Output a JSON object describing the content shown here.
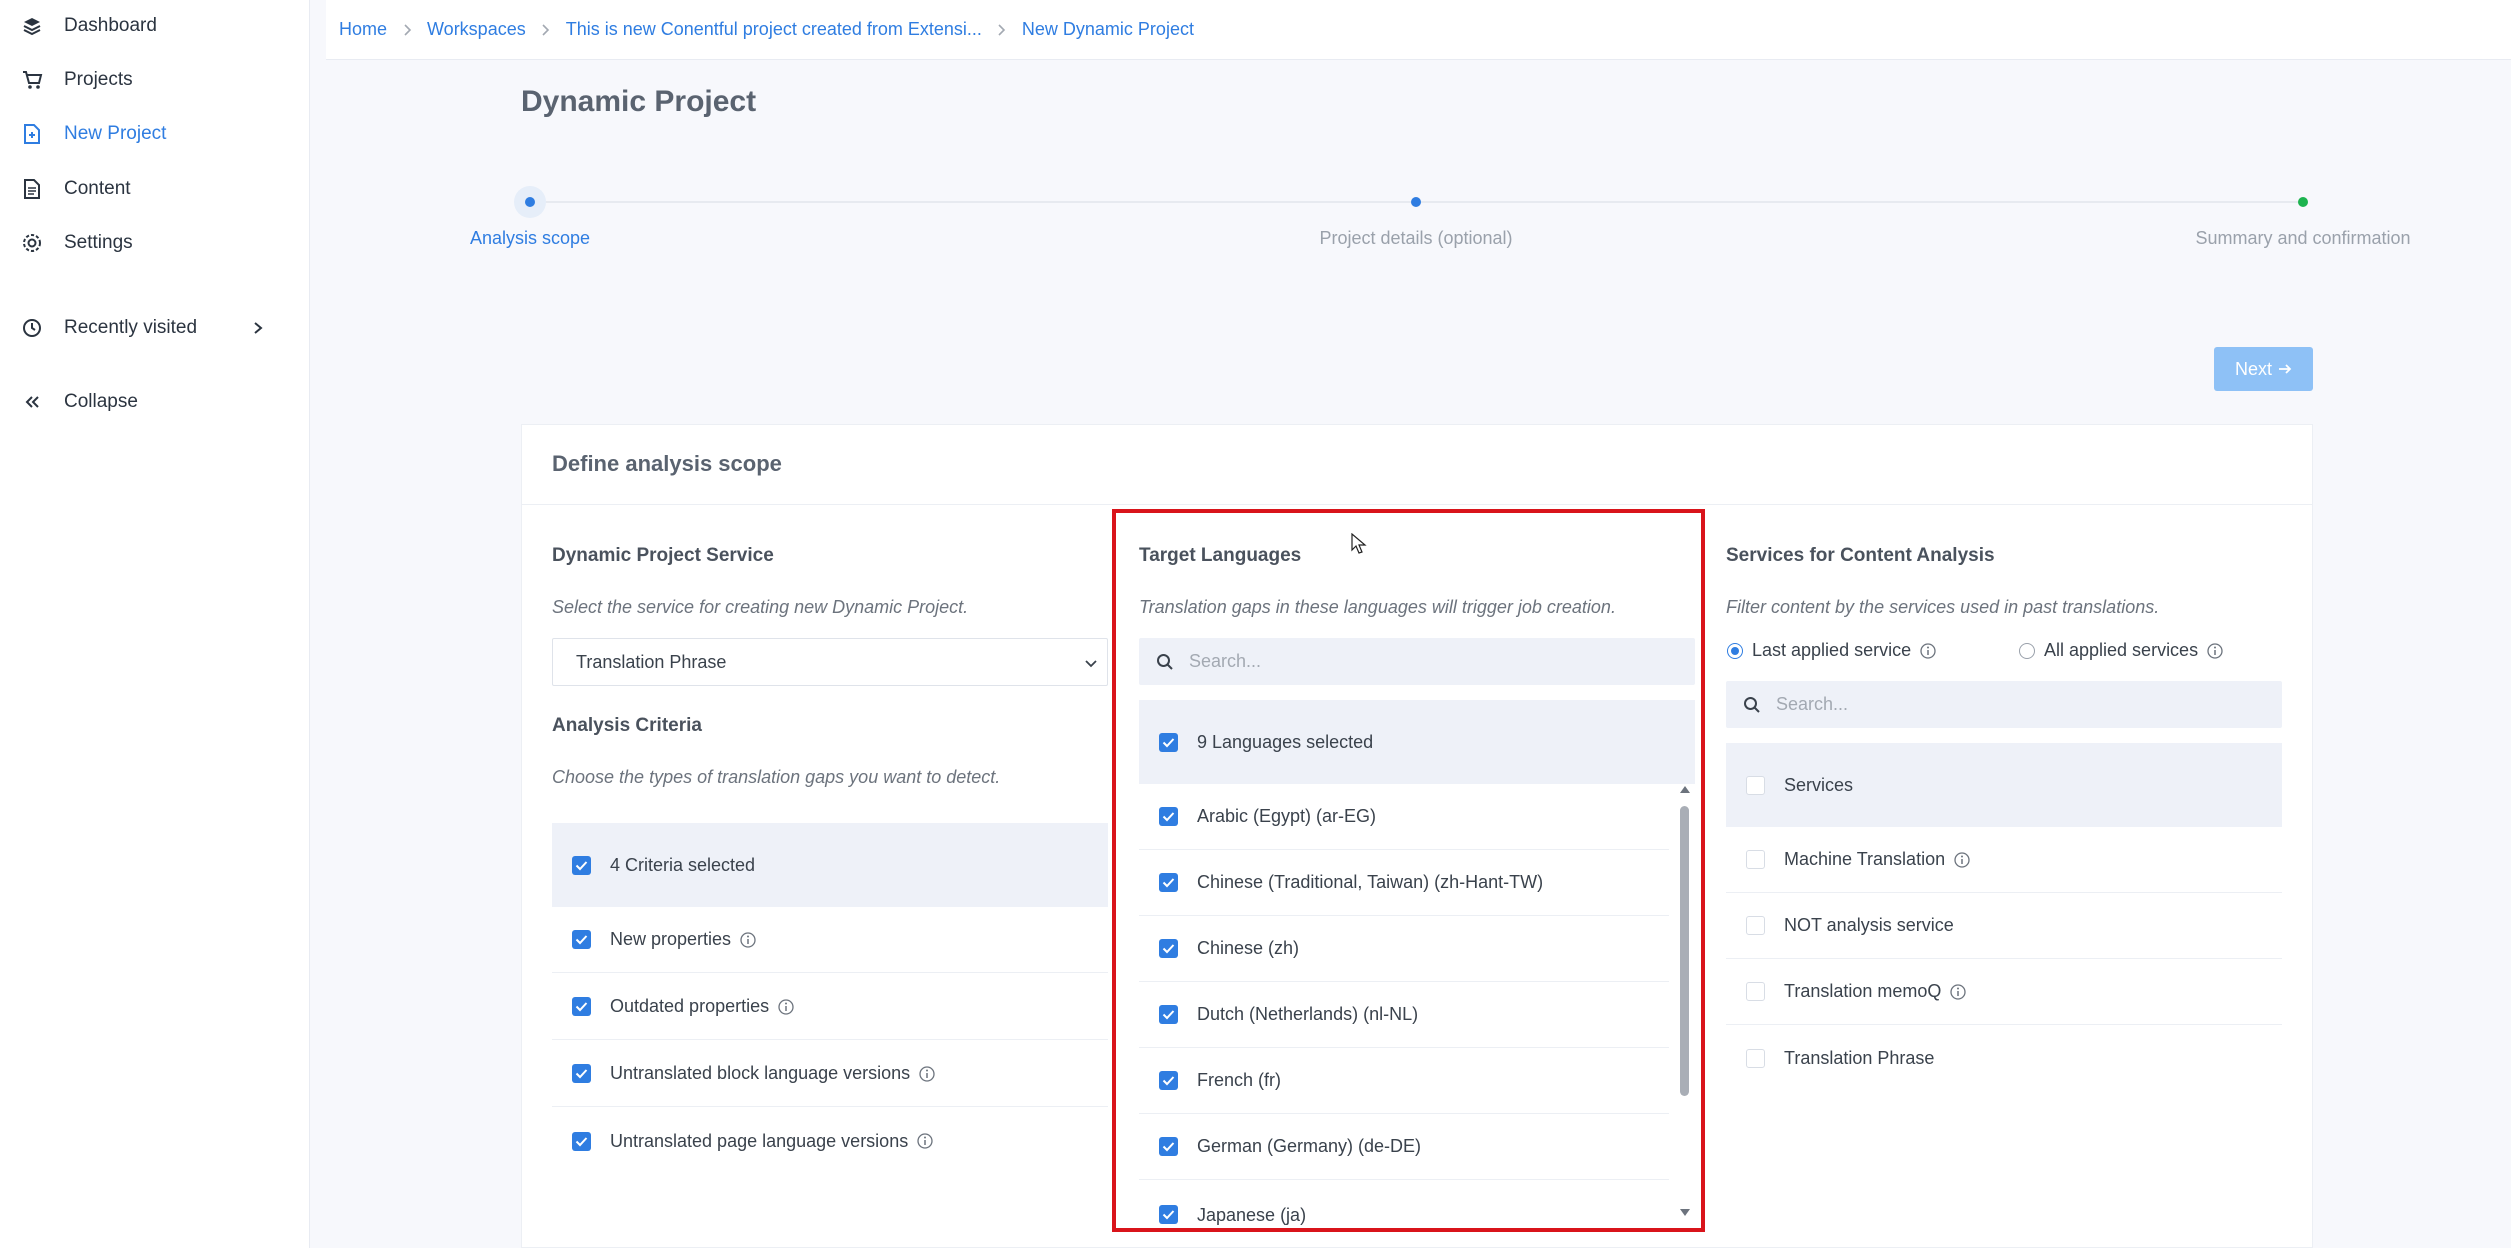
{
  "sidebar": {
    "items": [
      {
        "label": "Dashboard",
        "icon": "layers-icon"
      },
      {
        "label": "Projects",
        "icon": "cart-icon"
      },
      {
        "label": "New Project",
        "icon": "new-file-icon",
        "active": true
      },
      {
        "label": "Content",
        "icon": "document-icon"
      },
      {
        "label": "Settings",
        "icon": "gear-icon"
      }
    ],
    "recently_visited": "Recently visited",
    "collapse": "Collapse"
  },
  "breadcrumb": [
    "Home",
    "Workspaces",
    "This is new Conentful project created from Extensi...",
    "New Dynamic Project"
  ],
  "page_title": "Dynamic Project",
  "stepper": {
    "steps": [
      "Analysis scope",
      "Project details (optional)",
      "Summary and confirmation"
    ],
    "active_index": 0
  },
  "next_button": "Next",
  "card": {
    "title": "Define analysis scope",
    "service": {
      "title": "Dynamic Project Service",
      "description": "Select the service for creating new Dynamic Project.",
      "selected": "Translation Phrase"
    },
    "criteria": {
      "title": "Analysis Criteria",
      "description": "Choose the types of translation gaps you want to detect.",
      "header": "4 Criteria selected",
      "items": [
        {
          "label": "New properties",
          "info": true
        },
        {
          "label": "Outdated properties",
          "info": true
        },
        {
          "label": "Untranslated block language versions",
          "info": true
        },
        {
          "label": "Untranslated page language versions",
          "info": true
        }
      ]
    },
    "languages": {
      "title": "Target Languages",
      "description": "Translation gaps in these languages will trigger job creation.",
      "search_placeholder": "Search...",
      "header": "9 Languages selected",
      "items": [
        "Arabic (Egypt) (ar-EG)",
        "Chinese (Traditional, Taiwan) (zh-Hant-TW)",
        "Chinese (zh)",
        "Dutch (Netherlands) (nl-NL)",
        "French (fr)",
        "German (Germany) (de-DE)",
        "Japanese (ja)"
      ]
    },
    "services": {
      "title": "Services for Content Analysis",
      "description": "Filter content by the services used in past translations.",
      "radio_last": "Last applied service",
      "radio_all": "All applied services",
      "search_placeholder": "Search...",
      "header": "Services",
      "items": [
        {
          "label": "Machine Translation",
          "info": true
        },
        {
          "label": "NOT analysis service",
          "info": false
        },
        {
          "label": "Translation memoQ",
          "info": true
        },
        {
          "label": "Translation Phrase",
          "info": false
        }
      ]
    }
  },
  "colors": {
    "accent": "#2f7de1",
    "highlight": "#d9141b",
    "final_step": "#1db34f"
  }
}
